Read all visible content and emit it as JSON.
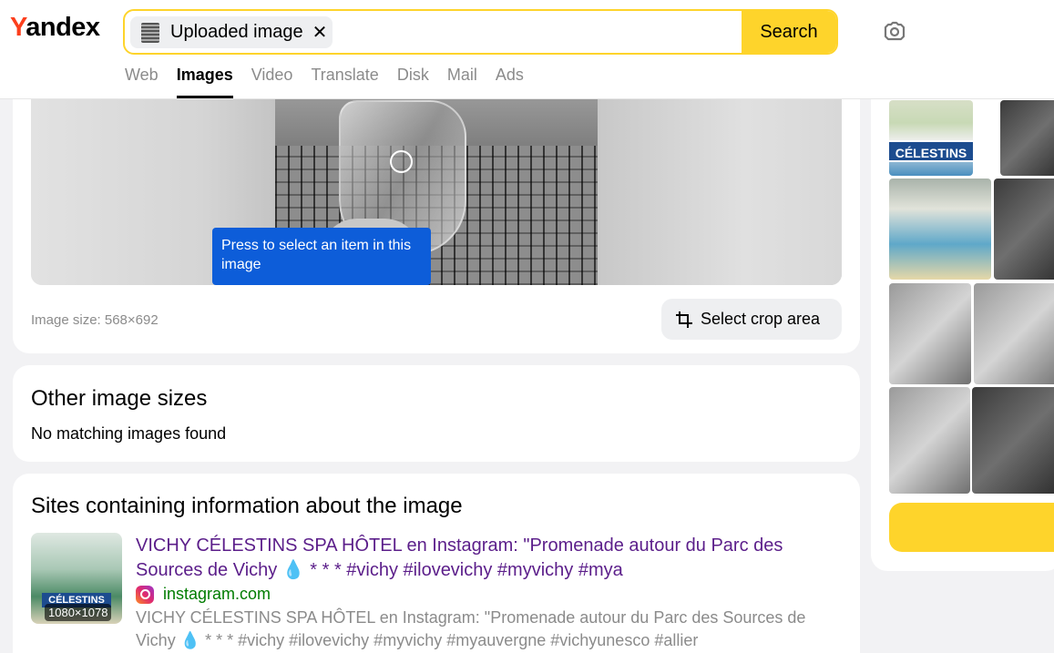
{
  "header": {
    "logo_first": "Y",
    "logo_rest": "andex",
    "search": {
      "chip_label": "Uploaded image",
      "chip_close": "✕",
      "button_label": "Search"
    },
    "camera_icon": "camera-icon",
    "tabs": [
      {
        "label": "Web",
        "active": false
      },
      {
        "label": "Images",
        "active": true
      },
      {
        "label": "Video",
        "active": false
      },
      {
        "label": "Translate",
        "active": false
      },
      {
        "label": "Disk",
        "active": false
      },
      {
        "label": "Mail",
        "active": false
      },
      {
        "label": "Ads",
        "active": false
      }
    ]
  },
  "preview": {
    "tooltip": "Press to select an item in this image",
    "image_size": "Image size: 568×692",
    "crop_button": "Select crop area"
  },
  "other_sizes": {
    "title": "Other image sizes",
    "message": "No matching images found"
  },
  "sites": {
    "title": "Sites containing information about the image",
    "result": {
      "thumb_sign": "CÉLESTINS",
      "thumb_size": "1080×1078",
      "title": "VICHY CÉLESTINS SPA HÔTEL en Instagram: \"Promenade autour du Parc des Sources de Vichy 💧 * * * #vichy #ilovevichy #myvichy #mya",
      "domain": "instagram.com",
      "snippet": "VICHY CÉLESTINS SPA HÔTEL en Instagram: \"Promenade autour du Parc des Sources de Vichy 💧 * * * #vichy #ilovevichy #myvichy #myauvergne #vichyunesco #allier"
    }
  },
  "sidebar": {
    "sign_text": "CÉLESTINS"
  },
  "colors": {
    "accent": "#fed42b",
    "logo_red": "#fc3f1d",
    "tooltip_blue": "#0d5dd9",
    "link_purple": "#5b1e8a",
    "domain_green": "#007c00"
  }
}
